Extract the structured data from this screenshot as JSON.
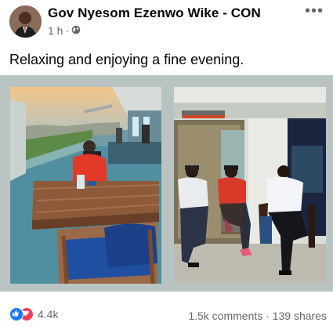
{
  "post": {
    "author": "Gov Nyesom Ezenwo Wike - CON",
    "time": "1 h",
    "separator": "·",
    "text": "Relaxing and enjoying a fine evening."
  },
  "footer": {
    "reaction_count": "4.4k",
    "comments": "1.5k comments",
    "separator": "·",
    "shares": "139 shares"
  },
  "icons": {
    "privacy": "globe-icon",
    "more": "more-options-icon",
    "like": "like-reaction-icon",
    "love": "love-reaction-icon"
  },
  "colors": {
    "like": "#1877f2",
    "love": "#f33e58",
    "meta_text": "#65676b",
    "photo_frame": "#b9c4c2"
  }
}
